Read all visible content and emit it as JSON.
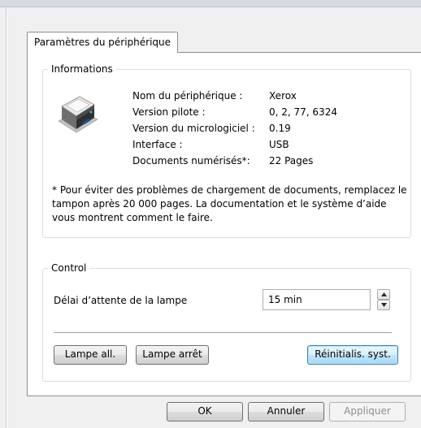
{
  "tab": {
    "label": "Paramètres du périphérique"
  },
  "info": {
    "title": "Informations",
    "icon": "printer-scanner-icon",
    "rows": [
      {
        "label": "Nom du périphérique :",
        "value": "Xerox"
      },
      {
        "label": "Version pilote :",
        "value": "0, 2, 77, 6324"
      },
      {
        "label": "Version du micrologiciel :",
        "value": "0.19"
      },
      {
        "label": "Interface :",
        "value": "USB"
      },
      {
        "label": "Documents numérisés*:",
        "value": "22 Pages"
      }
    ],
    "note": "* Pour éviter des problèmes de chargement de documents, remplacez le tampon après 20 000 pages. La documentation et le système d’aide vous montrent comment le faire."
  },
  "control": {
    "title": "Control",
    "lamp_label": "Délai d’attente de la lampe",
    "lamp_value": "15 min",
    "lamp_on_label": "Lampe all.",
    "lamp_off_label": "Lampe arrêt",
    "reset_label": "Réinitialis. syst."
  },
  "footer": {
    "ok_label": "OK",
    "cancel_label": "Annuler",
    "apply_label": "Appliquer"
  }
}
